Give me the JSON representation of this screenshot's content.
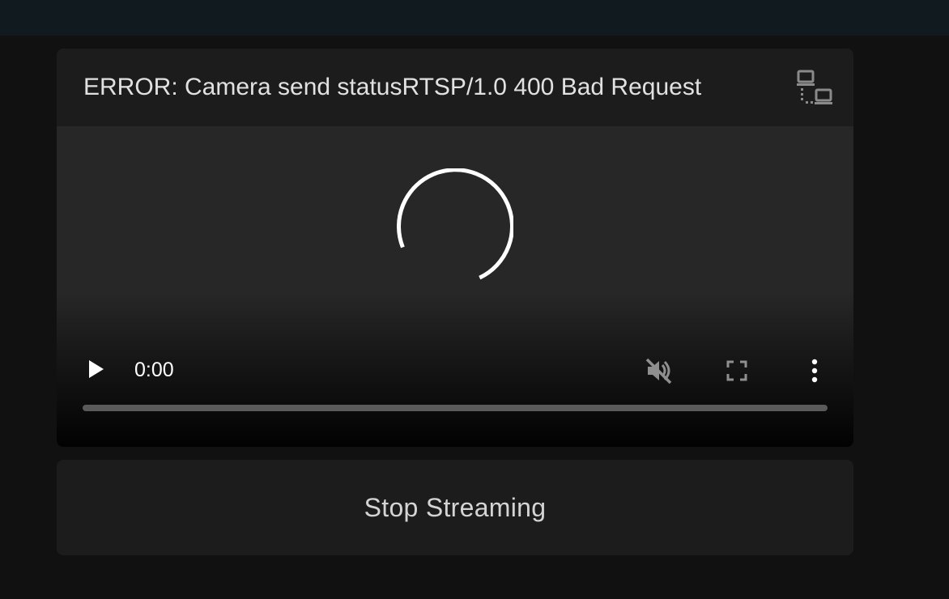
{
  "card": {
    "title": "ERROR: Camera send statusRTSP/1.0 400 Bad Request",
    "status_icon": "network-lan-icon"
  },
  "player": {
    "state": "loading",
    "time": "0:00",
    "progress": 0,
    "muted": true,
    "icons": {
      "play": "play-icon",
      "mute": "volume-off-icon",
      "fullscreen": "fullscreen-icon",
      "more": "more-vertical-icon",
      "spinner": "loading-spinner"
    }
  },
  "actions": {
    "stop_label": "Stop Streaming"
  },
  "colors": {
    "background": "#111111",
    "card": "#1c1c1c",
    "topbar": "#101a1f",
    "text": "#e1e1e1",
    "progress_track": "#5a5a5a"
  }
}
